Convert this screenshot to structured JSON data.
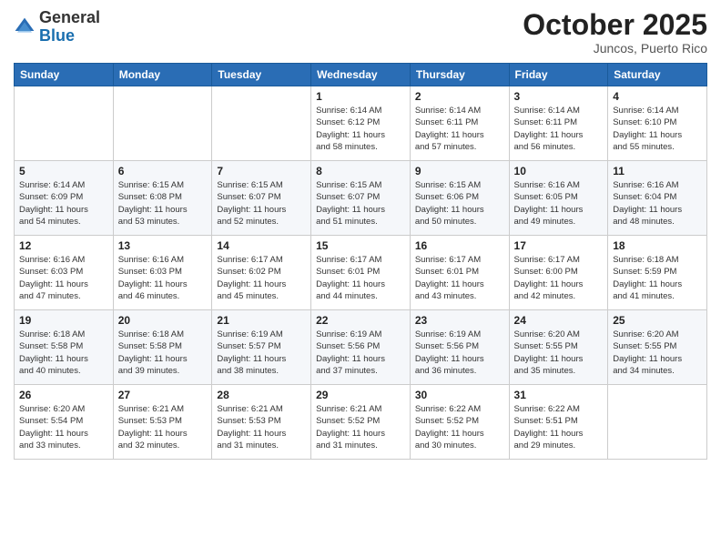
{
  "header": {
    "logo_general": "General",
    "logo_blue": "Blue",
    "month": "October 2025",
    "location": "Juncos, Puerto Rico"
  },
  "days_of_week": [
    "Sunday",
    "Monday",
    "Tuesday",
    "Wednesday",
    "Thursday",
    "Friday",
    "Saturday"
  ],
  "weeks": [
    [
      {
        "num": "",
        "info": ""
      },
      {
        "num": "",
        "info": ""
      },
      {
        "num": "",
        "info": ""
      },
      {
        "num": "1",
        "info": "Sunrise: 6:14 AM\nSunset: 6:12 PM\nDaylight: 11 hours\nand 58 minutes."
      },
      {
        "num": "2",
        "info": "Sunrise: 6:14 AM\nSunset: 6:11 PM\nDaylight: 11 hours\nand 57 minutes."
      },
      {
        "num": "3",
        "info": "Sunrise: 6:14 AM\nSunset: 6:11 PM\nDaylight: 11 hours\nand 56 minutes."
      },
      {
        "num": "4",
        "info": "Sunrise: 6:14 AM\nSunset: 6:10 PM\nDaylight: 11 hours\nand 55 minutes."
      }
    ],
    [
      {
        "num": "5",
        "info": "Sunrise: 6:14 AM\nSunset: 6:09 PM\nDaylight: 11 hours\nand 54 minutes."
      },
      {
        "num": "6",
        "info": "Sunrise: 6:15 AM\nSunset: 6:08 PM\nDaylight: 11 hours\nand 53 minutes."
      },
      {
        "num": "7",
        "info": "Sunrise: 6:15 AM\nSunset: 6:07 PM\nDaylight: 11 hours\nand 52 minutes."
      },
      {
        "num": "8",
        "info": "Sunrise: 6:15 AM\nSunset: 6:07 PM\nDaylight: 11 hours\nand 51 minutes."
      },
      {
        "num": "9",
        "info": "Sunrise: 6:15 AM\nSunset: 6:06 PM\nDaylight: 11 hours\nand 50 minutes."
      },
      {
        "num": "10",
        "info": "Sunrise: 6:16 AM\nSunset: 6:05 PM\nDaylight: 11 hours\nand 49 minutes."
      },
      {
        "num": "11",
        "info": "Sunrise: 6:16 AM\nSunset: 6:04 PM\nDaylight: 11 hours\nand 48 minutes."
      }
    ],
    [
      {
        "num": "12",
        "info": "Sunrise: 6:16 AM\nSunset: 6:03 PM\nDaylight: 11 hours\nand 47 minutes."
      },
      {
        "num": "13",
        "info": "Sunrise: 6:16 AM\nSunset: 6:03 PM\nDaylight: 11 hours\nand 46 minutes."
      },
      {
        "num": "14",
        "info": "Sunrise: 6:17 AM\nSunset: 6:02 PM\nDaylight: 11 hours\nand 45 minutes."
      },
      {
        "num": "15",
        "info": "Sunrise: 6:17 AM\nSunset: 6:01 PM\nDaylight: 11 hours\nand 44 minutes."
      },
      {
        "num": "16",
        "info": "Sunrise: 6:17 AM\nSunset: 6:01 PM\nDaylight: 11 hours\nand 43 minutes."
      },
      {
        "num": "17",
        "info": "Sunrise: 6:17 AM\nSunset: 6:00 PM\nDaylight: 11 hours\nand 42 minutes."
      },
      {
        "num": "18",
        "info": "Sunrise: 6:18 AM\nSunset: 5:59 PM\nDaylight: 11 hours\nand 41 minutes."
      }
    ],
    [
      {
        "num": "19",
        "info": "Sunrise: 6:18 AM\nSunset: 5:58 PM\nDaylight: 11 hours\nand 40 minutes."
      },
      {
        "num": "20",
        "info": "Sunrise: 6:18 AM\nSunset: 5:58 PM\nDaylight: 11 hours\nand 39 minutes."
      },
      {
        "num": "21",
        "info": "Sunrise: 6:19 AM\nSunset: 5:57 PM\nDaylight: 11 hours\nand 38 minutes."
      },
      {
        "num": "22",
        "info": "Sunrise: 6:19 AM\nSunset: 5:56 PM\nDaylight: 11 hours\nand 37 minutes."
      },
      {
        "num": "23",
        "info": "Sunrise: 6:19 AM\nSunset: 5:56 PM\nDaylight: 11 hours\nand 36 minutes."
      },
      {
        "num": "24",
        "info": "Sunrise: 6:20 AM\nSunset: 5:55 PM\nDaylight: 11 hours\nand 35 minutes."
      },
      {
        "num": "25",
        "info": "Sunrise: 6:20 AM\nSunset: 5:55 PM\nDaylight: 11 hours\nand 34 minutes."
      }
    ],
    [
      {
        "num": "26",
        "info": "Sunrise: 6:20 AM\nSunset: 5:54 PM\nDaylight: 11 hours\nand 33 minutes."
      },
      {
        "num": "27",
        "info": "Sunrise: 6:21 AM\nSunset: 5:53 PM\nDaylight: 11 hours\nand 32 minutes."
      },
      {
        "num": "28",
        "info": "Sunrise: 6:21 AM\nSunset: 5:53 PM\nDaylight: 11 hours\nand 31 minutes."
      },
      {
        "num": "29",
        "info": "Sunrise: 6:21 AM\nSunset: 5:52 PM\nDaylight: 11 hours\nand 31 minutes."
      },
      {
        "num": "30",
        "info": "Sunrise: 6:22 AM\nSunset: 5:52 PM\nDaylight: 11 hours\nand 30 minutes."
      },
      {
        "num": "31",
        "info": "Sunrise: 6:22 AM\nSunset: 5:51 PM\nDaylight: 11 hours\nand 29 minutes."
      },
      {
        "num": "",
        "info": ""
      }
    ]
  ]
}
